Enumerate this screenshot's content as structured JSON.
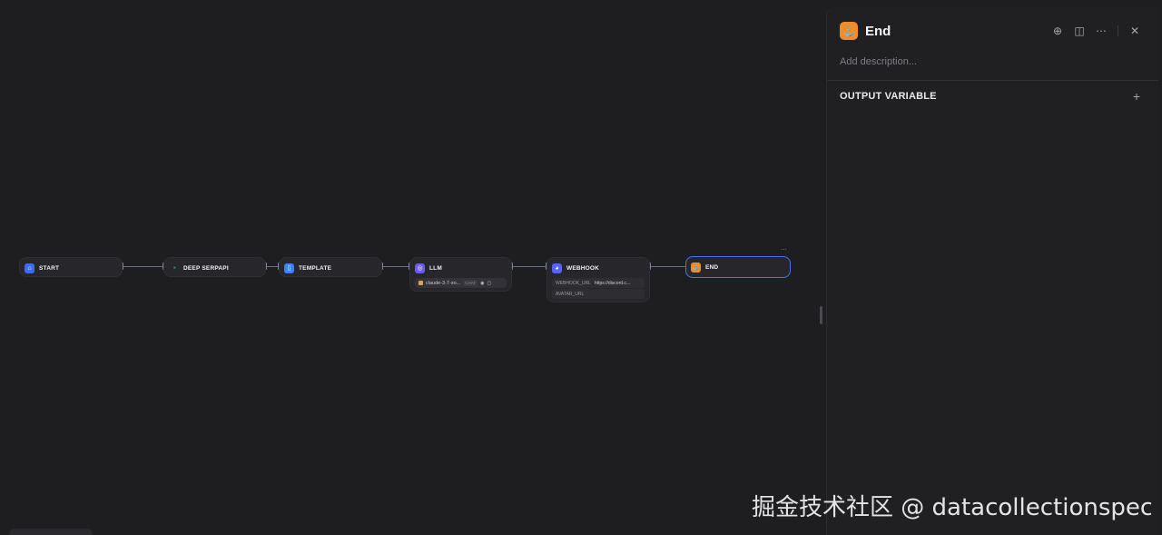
{
  "workflow": {
    "nodes": [
      {
        "id": "start",
        "title": "START",
        "icon": "home-icon",
        "color": "#3b6cf6"
      },
      {
        "id": "deep-serpapi",
        "title": "DEEP SERPAPI",
        "icon": "serpapi-icon",
        "color": "#22b573"
      },
      {
        "id": "template",
        "title": "TEMPLATE",
        "icon": "template-icon",
        "color": "#3b82f6"
      },
      {
        "id": "llm",
        "title": "LLM",
        "icon": "llm-icon",
        "color": "#6c5ce7",
        "model": "claude-3-7-so...",
        "model_tag": "CHAT"
      },
      {
        "id": "webhook",
        "title": "WEBHOOK",
        "icon": "discord-icon",
        "color": "#5865f2",
        "fields": [
          {
            "key": "WEBHOOK_URL",
            "value": "https://discord.c..."
          },
          {
            "key": "AVATAR_URL",
            "value": ""
          }
        ]
      },
      {
        "id": "end",
        "title": "END",
        "icon": "end-icon",
        "color": "#ef8d2a"
      }
    ],
    "more_label": "..."
  },
  "panel": {
    "title": "End",
    "description_placeholder": "Add description...",
    "section_title": "OUTPUT VARIABLE",
    "add_label": "+"
  },
  "watermark": "掘金技术社区 @ datacollectionspecia"
}
